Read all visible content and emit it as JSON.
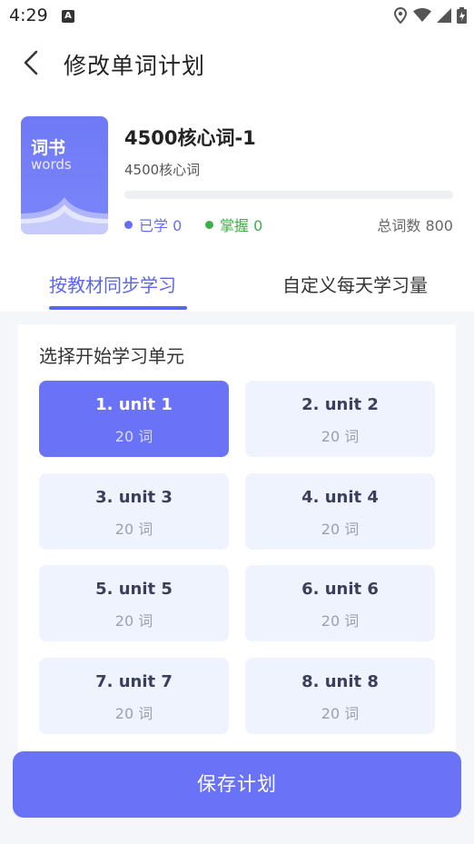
{
  "status_bar": {
    "time": "4:29",
    "a_label": "A"
  },
  "header": {
    "title": "修改单词计划"
  },
  "book": {
    "cover_title": "词书",
    "cover_subtitle": "words",
    "name": "4500核心词-1",
    "desc": "4500核心词",
    "progress": 0,
    "learned_label": "已学 0",
    "mastered_label": "掌握 0",
    "total_label": "总词数 800",
    "colors": {
      "learned": "#6470f3",
      "mastered": "#3fae48"
    }
  },
  "tabs": [
    {
      "label": "按教材同步学习",
      "active": true
    },
    {
      "label": "自定义每天学习量",
      "active": false
    }
  ],
  "panel": {
    "title": "选择开始学习单元"
  },
  "units": [
    {
      "name": "1. unit 1",
      "count": "20 词",
      "active": true
    },
    {
      "name": "2. unit 2",
      "count": "20 词",
      "active": false
    },
    {
      "name": "3. unit 3",
      "count": "20 词",
      "active": false
    },
    {
      "name": "4. unit 4",
      "count": "20 词",
      "active": false
    },
    {
      "name": "5. unit 5",
      "count": "20 词",
      "active": false
    },
    {
      "name": "6. unit 6",
      "count": "20 词",
      "active": false
    },
    {
      "name": "7. unit 7",
      "count": "20 词",
      "active": false
    },
    {
      "name": "8. unit 8",
      "count": "20 词",
      "active": false
    }
  ],
  "save_button": {
    "label": "保存计划"
  },
  "accent_color": "#6a73f5"
}
